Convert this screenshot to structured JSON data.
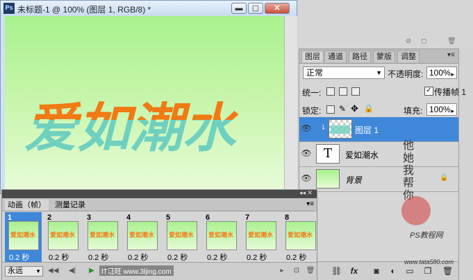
{
  "document": {
    "title": "未标题-1 @ 100% (图层 1, RGB/8) *",
    "artwork_text": "爱如潮水",
    "app_badge": "Ps",
    "colors": {
      "artwork_orange": "#f07a13",
      "artwork_teal": "#6fd0c0"
    }
  },
  "layers_panel": {
    "tabs": [
      "图层",
      "通道",
      "路径",
      "蒙版",
      "调整"
    ],
    "blend_mode": "正常",
    "opacity_label": "不透明度:",
    "opacity_value": "100%",
    "unify_label": "统一:",
    "propagate_label": "传播帧 1",
    "lock_label": "锁定:",
    "fill_label": "填充:",
    "fill_value": "100%",
    "layers": [
      {
        "name": "图层 1",
        "type": "pixel",
        "selected": true
      },
      {
        "name": "爱如潮水",
        "type": "text",
        "thumb_glyph": "T"
      },
      {
        "name": "背景",
        "type": "background",
        "locked": true
      }
    ]
  },
  "animation_panel": {
    "tabs": [
      "动画（帧）",
      "测量记录"
    ],
    "frames": [
      {
        "number": "1",
        "delay": "0.2 秒"
      },
      {
        "number": "2",
        "delay": "0.2 秒"
      },
      {
        "number": "3",
        "delay": "0.2 秒"
      },
      {
        "number": "4",
        "delay": "0.2 秒"
      },
      {
        "number": "5",
        "delay": "0.2 秒"
      },
      {
        "number": "6",
        "delay": "0.2 秒"
      },
      {
        "number": "7",
        "delay": "0.2 秒"
      },
      {
        "number": "8",
        "delay": "0.2 秒"
      }
    ],
    "loop_value": "永远"
  },
  "watermark": {
    "vertical_text": "他她我帮你",
    "site_label": "PS教程网",
    "url": "www.tata580.com",
    "overlay_mark": "IT旺旺 www.3ljing.com"
  },
  "icons": [
    "photoshop-icon",
    "minimize-icon",
    "restore-icon",
    "close-icon",
    "eye-icon",
    "link-icon",
    "lock-icon",
    "play-icon",
    "rewind-icon",
    "fx-icon",
    "trash-icon",
    "new-layer-icon",
    "folder-icon",
    "mask-icon",
    "adjustment-icon",
    "panel-menu-icon"
  ]
}
